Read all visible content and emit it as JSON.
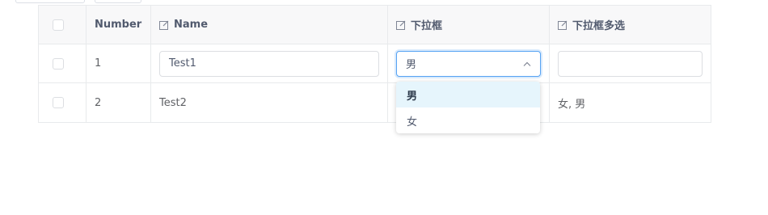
{
  "columns": {
    "number": "Number",
    "name": "Name",
    "select": "下拉框",
    "multi_select": "下拉框多选"
  },
  "rows": [
    {
      "number": "1",
      "name": "Test1",
      "select": "男",
      "multi": ""
    },
    {
      "number": "2",
      "name": "Test2",
      "select": "",
      "multi": "女, 男"
    }
  ],
  "dropdown": {
    "options": [
      "男",
      "女"
    ],
    "selected": "男"
  },
  "colors": {
    "header_bg": "#f8f8f9",
    "border": "#e8eaec",
    "focus_border": "#57a3f3",
    "selected_option_bg": "#e6f5fc"
  }
}
